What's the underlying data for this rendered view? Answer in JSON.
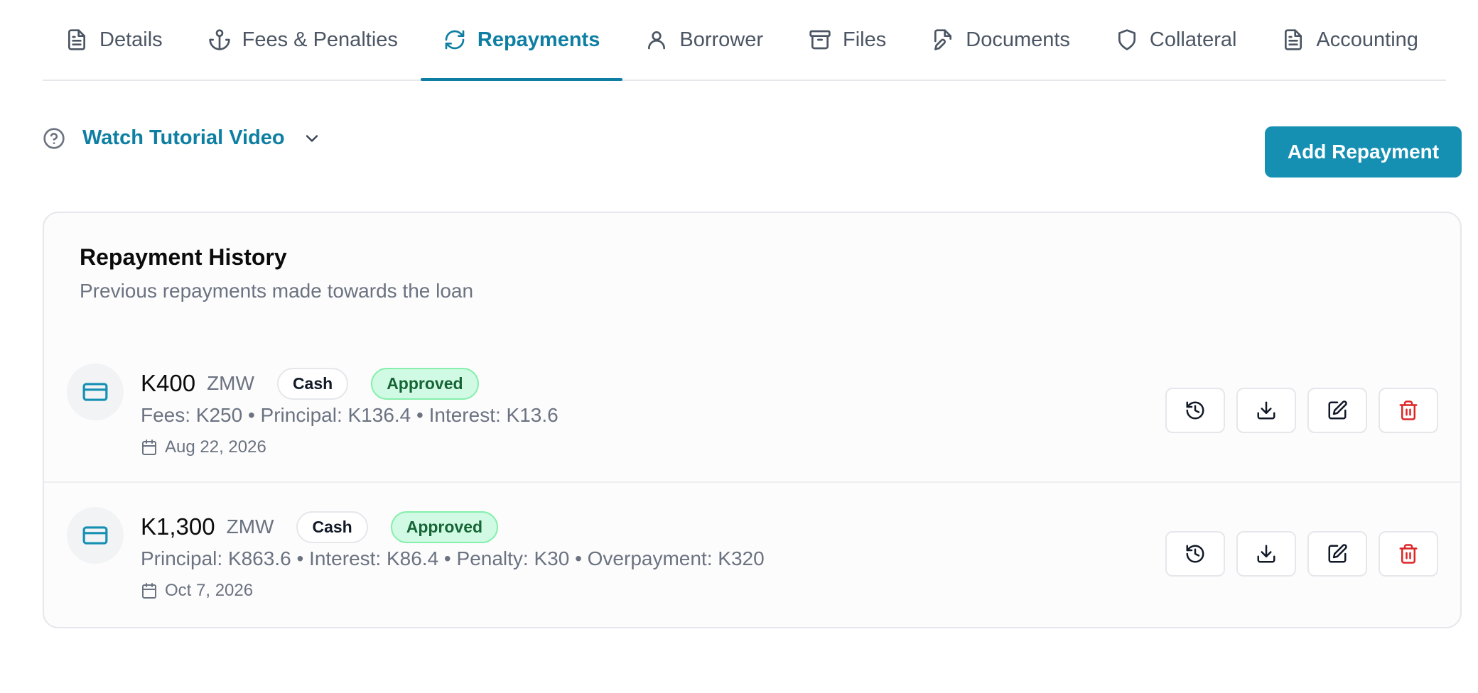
{
  "tabs": [
    {
      "label": "Details",
      "icon": "file-text-icon",
      "active": false
    },
    {
      "label": "Fees & Penalties",
      "icon": "anchor-icon",
      "active": false
    },
    {
      "label": "Repayments",
      "icon": "refresh-icon",
      "active": true
    },
    {
      "label": "Borrower",
      "icon": "user-icon",
      "active": false
    },
    {
      "label": "Files",
      "icon": "archive-icon",
      "active": false
    },
    {
      "label": "Documents",
      "icon": "file-edit-icon",
      "active": false
    },
    {
      "label": "Collateral",
      "icon": "shield-icon",
      "active": false
    },
    {
      "label": "Accounting",
      "icon": "file-text-icon",
      "active": false
    }
  ],
  "tutorial": {
    "label": "Watch Tutorial Video"
  },
  "add_button": {
    "label": "Add Repayment"
  },
  "history": {
    "title": "Repayment History",
    "subtitle": "Previous repayments made towards the loan",
    "items": [
      {
        "amount": "K400",
        "currency": "ZMW",
        "method": "Cash",
        "status": "Approved",
        "breakdown": "Fees: K250 • Principal: K136.4 • Interest: K13.6",
        "date": "Aug 22, 2026"
      },
      {
        "amount": "K1,300",
        "currency": "ZMW",
        "method": "Cash",
        "status": "Approved",
        "breakdown": "Principal: K863.6 • Interest: K86.4 • Penalty: K30 • Overpayment: K320",
        "date": "Oct 7, 2026"
      }
    ]
  },
  "colors": {
    "accent": "#0e7fa3",
    "button": "#1590b3",
    "approved_bg": "#d1fae5",
    "approved_text": "#166534",
    "delete": "#dc2626"
  }
}
